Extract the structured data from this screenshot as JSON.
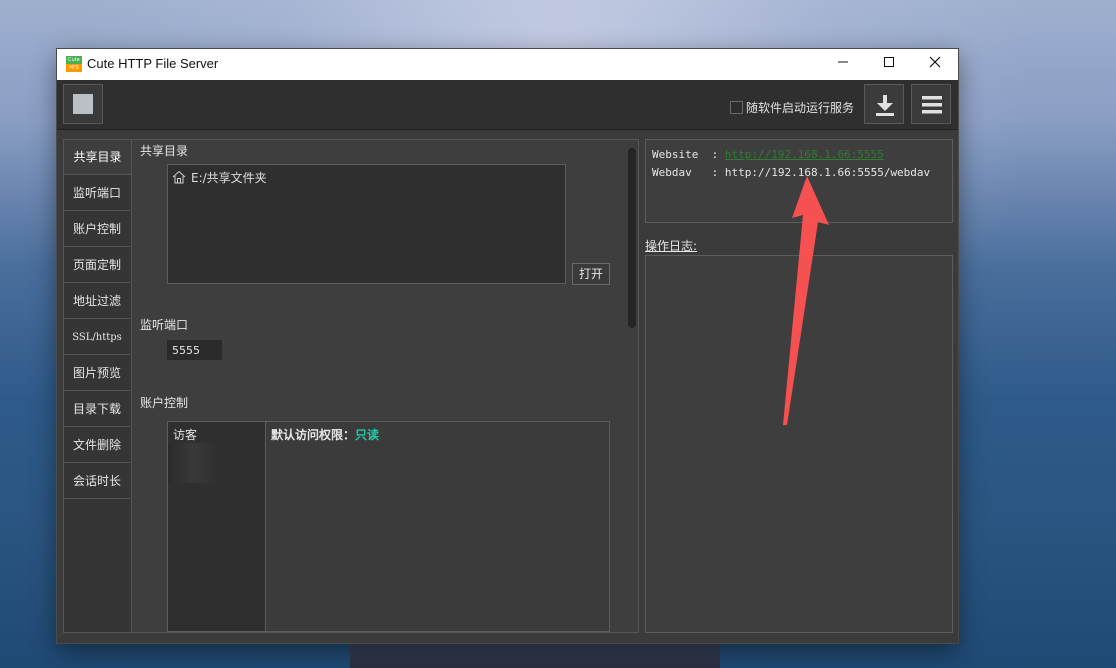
{
  "window": {
    "title": "Cute HTTP File Server",
    "icon_text_top": "Cute",
    "icon_text_bottom": "HFS",
    "controls": {
      "minimize": "—",
      "maximize": "☐",
      "close": "✕"
    }
  },
  "toolbar": {
    "autostart_label": "随软件启动运行服务",
    "autostart_checked": false,
    "download_icon": "download-icon",
    "menu_icon": "hamburger-menu-icon"
  },
  "tabs": [
    {
      "label": "共享目录",
      "active": true
    },
    {
      "label": "监听端口"
    },
    {
      "label": "账户控制"
    },
    {
      "label": "页面定制"
    },
    {
      "label": "地址过滤"
    },
    {
      "label": "SSL/https"
    },
    {
      "label": "图片预览"
    },
    {
      "label": "目录下载"
    },
    {
      "label": "文件删除"
    },
    {
      "label": "会话时长"
    }
  ],
  "share": {
    "section_label": "共享目录",
    "items": [
      {
        "path": "E:/共享文件夹"
      }
    ],
    "open_button": "打开"
  },
  "port": {
    "section_label": "监听端口",
    "value": "5555"
  },
  "account": {
    "section_label": "账户控制",
    "users": [
      "访客"
    ],
    "permission_label": "默认访问权限：",
    "permission_value": "只读"
  },
  "addresses": {
    "website_label": "Website",
    "website_sep": ":",
    "website_url": "http://192.168.1.66:5555",
    "webdav_label": "Webdav",
    "webdav_sep": ":",
    "webdav_url": "http://192.168.1.66:5555/webdav"
  },
  "log": {
    "label": "操作日志:"
  },
  "colors": {
    "accent_readonly": "#21c8a8",
    "link": "#2e7d32",
    "annotation_arrow": "#ff4d4d"
  }
}
